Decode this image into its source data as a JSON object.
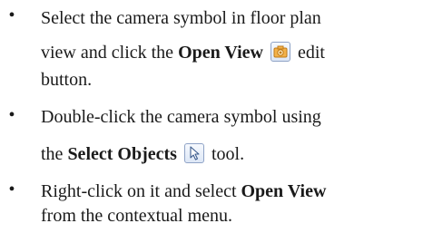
{
  "bullet_char": "•",
  "items": [
    {
      "line1": "Select the camera symbol in floor plan",
      "line2_pre": "view and click the ",
      "line2_bold": "Open View",
      "line2_post": " edit",
      "line3": "button.",
      "icon": "open-view-camera-icon"
    },
    {
      "line1": "Double-click the camera symbol using",
      "line2_pre": "the ",
      "line2_bold": "Select Objects",
      "line2_post": " tool.",
      "icon": "select-objects-arrow-icon"
    },
    {
      "line1_pre": "Right-click on it and select ",
      "line1_bold": "Open View",
      "line2": "from the contextual menu."
    }
  ],
  "colors": {
    "text": "#1a1a1a",
    "icon_border": "#8fa3c6",
    "camera_orange": "#e8a23c"
  }
}
